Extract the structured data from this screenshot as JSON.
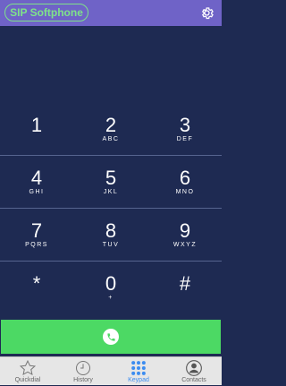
{
  "app": {
    "title": "SIP Softphone",
    "settings_icon": "gear-icon"
  },
  "keypad": {
    "keys": [
      {
        "digit": "1",
        "letters": ""
      },
      {
        "digit": "2",
        "letters": "ABC"
      },
      {
        "digit": "3",
        "letters": "DEF"
      },
      {
        "digit": "4",
        "letters": "GHI"
      },
      {
        "digit": "5",
        "letters": "JKL"
      },
      {
        "digit": "6",
        "letters": "MNO"
      },
      {
        "digit": "7",
        "letters": "PQRS"
      },
      {
        "digit": "8",
        "letters": "TUV"
      },
      {
        "digit": "9",
        "letters": "WXYZ"
      },
      {
        "digit": "*",
        "letters": ""
      },
      {
        "digit": "0",
        "letters": "+"
      },
      {
        "digit": "#",
        "letters": ""
      }
    ]
  },
  "call_button": {
    "icon": "phone-icon",
    "color": "#4cd964"
  },
  "tabs": [
    {
      "label": "Quickdial",
      "icon": "star-icon",
      "active": false
    },
    {
      "label": "History",
      "icon": "clock-icon",
      "active": false
    },
    {
      "label": "Keypad",
      "icon": "keypad-icon",
      "active": true
    },
    {
      "label": "Contacts",
      "icon": "contact-icon",
      "active": false
    }
  ],
  "colors": {
    "header": "#6f63c7",
    "background": "#1e2a52",
    "accent": "#3c8cf0"
  }
}
